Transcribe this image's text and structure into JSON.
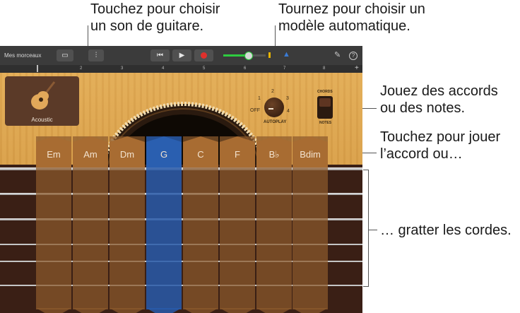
{
  "callouts": {
    "guitar_sound": "Touchez pour choisir\nun son de guitare.",
    "autoplay": "Tournez pour choisir un\nmodèle automatique.",
    "chords_notes": "Jouez des accords\nou des notes.",
    "touch_chord": "Touchez pour jouer\nl’accord ou…",
    "strum": "… gratter les cordes."
  },
  "toolbar": {
    "my_songs": "Mes morceaux",
    "view_icon": "view-toggle-icon",
    "mixer_icon": "mixer-icon",
    "rewind_icon": "rewind-icon",
    "play_icon": "play-icon",
    "record_icon": "record-icon",
    "metronome_icon": "metronome-icon",
    "settings_icon": "wrench-icon",
    "help_icon": "help-icon",
    "volume_level": 0.6,
    "accent_color": "#2ecc40",
    "record_color": "#e0302c",
    "metronome_color": "#3a7bd5"
  },
  "ruler": {
    "ticks": [
      "2",
      "3",
      "4",
      "5",
      "6",
      "7",
      "8"
    ],
    "add_label": "+"
  },
  "track": {
    "name": "Acoustic",
    "icon": "acoustic-guitar-icon"
  },
  "autoplay": {
    "label": "AUTOPLAY",
    "positions": [
      "OFF",
      "1",
      "2",
      "3",
      "4"
    ],
    "selected": "OFF"
  },
  "mode_switch": {
    "top_label": "CHORDS",
    "bottom_label": "NOTES",
    "selected": "CHORDS"
  },
  "chords": {
    "items": [
      "Em",
      "Am",
      "Dm",
      "G",
      "C",
      "F",
      "B♭",
      "Bdim"
    ],
    "active": "G"
  },
  "strings_count": 6
}
